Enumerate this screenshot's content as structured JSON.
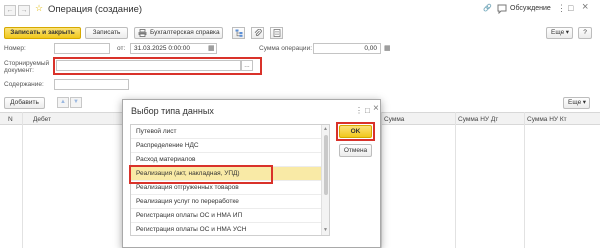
{
  "titlebar": {
    "title": "Операция (создание)",
    "discussion_label": "Обсуждение",
    "back_glyph": "←",
    "forward_glyph": "→",
    "star_glyph": "☆",
    "link_glyph": "🔗",
    "more_glyph": "⋮",
    "maximize_glyph": "□",
    "close_glyph": "×"
  },
  "toolbar": {
    "save_close_label": "Записать и закрыть",
    "save_label": "Записать",
    "accounting_ref_label": "Бухгалтерская справка",
    "more_label": "Еще",
    "dropdown_glyph": "▾",
    "help_label": "?",
    "icon_names": [
      "printer-icon",
      "structure-icon",
      "attach-icon",
      "report-icon"
    ]
  },
  "form": {
    "number_label": "Номер:",
    "number_value": "",
    "date_label": "от:",
    "date_value": "31.03.2025  0:00:00",
    "calendar_glyph": "▦",
    "sum_label": "Сумма операции:",
    "sum_value": "0,00",
    "calc_glyph": "▦",
    "storno_label_1": "Сторнируемый",
    "storno_label_2": "документ:",
    "storno_value": "",
    "storno_dots": "...",
    "content_label": "Содержание:",
    "content_value": ""
  },
  "table_toolbar": {
    "add_label": "Добавить",
    "up_glyph": "▲",
    "down_glyph": "▼",
    "more_label": "Еще"
  },
  "table": {
    "columns": [
      "N",
      "Дебет",
      "Сумма",
      "Сумма НУ Дт",
      "Сумма НУ Кт"
    ]
  },
  "dialog": {
    "title": "Выбор типа данных",
    "more_glyph": "⋮",
    "maximize_glyph": "□",
    "close_glyph": "×",
    "ok_label": "OK",
    "cancel_label": "Отмена",
    "items": [
      "Путевой лист",
      "Распределение НДС",
      "Расход материалов",
      "Реализация (акт, накладная, УПД)",
      "Реализация отгруженных товаров",
      "Реализация услуг по переработке",
      "Регистрация оплаты ОС и НМА ИП",
      "Регистрация оплаты ОС и НМА УСН"
    ],
    "selected_index": 3
  },
  "colors": {
    "accent_yellow": "#f6d02d",
    "highlight_red": "#d9322a",
    "selection": "#f9eaa6"
  }
}
